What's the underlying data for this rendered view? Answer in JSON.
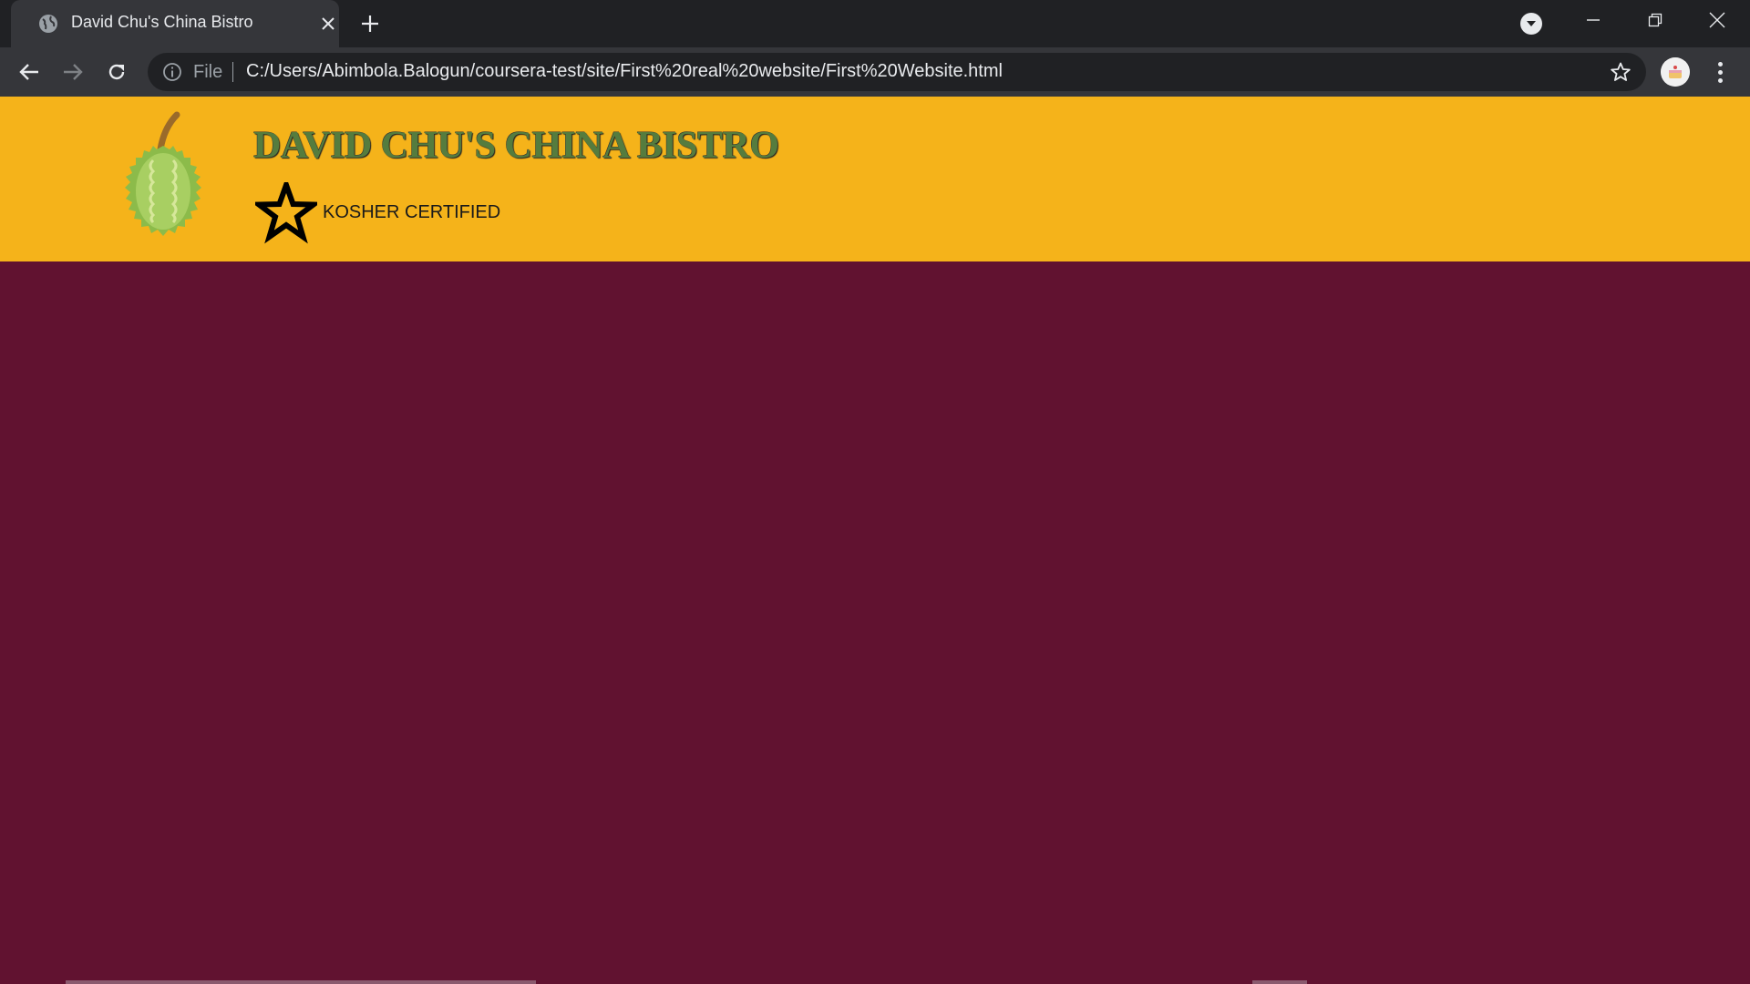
{
  "browser": {
    "tab": {
      "title": "David Chu's China Bistro",
      "favicon": "globe-icon"
    },
    "toolbar": {
      "scheme_label": "File",
      "url": "C:/Users/Abimbola.Balogun/coursera-test/site/First%20real%20website/First%20Website.html"
    },
    "colors": {
      "frame": "#202124",
      "toolbar": "#35363a",
      "text": "#e8eaed"
    }
  },
  "page": {
    "header": {
      "title": "DAVID CHU'S CHINA BISTRO",
      "badge_label": "KOSHER CERTIFIED",
      "logo": "durian-logo",
      "badge_icon": "star-icon"
    },
    "colors": {
      "header_background": "#f5b31a",
      "body_background": "#611230",
      "title": "#557c3e"
    }
  }
}
